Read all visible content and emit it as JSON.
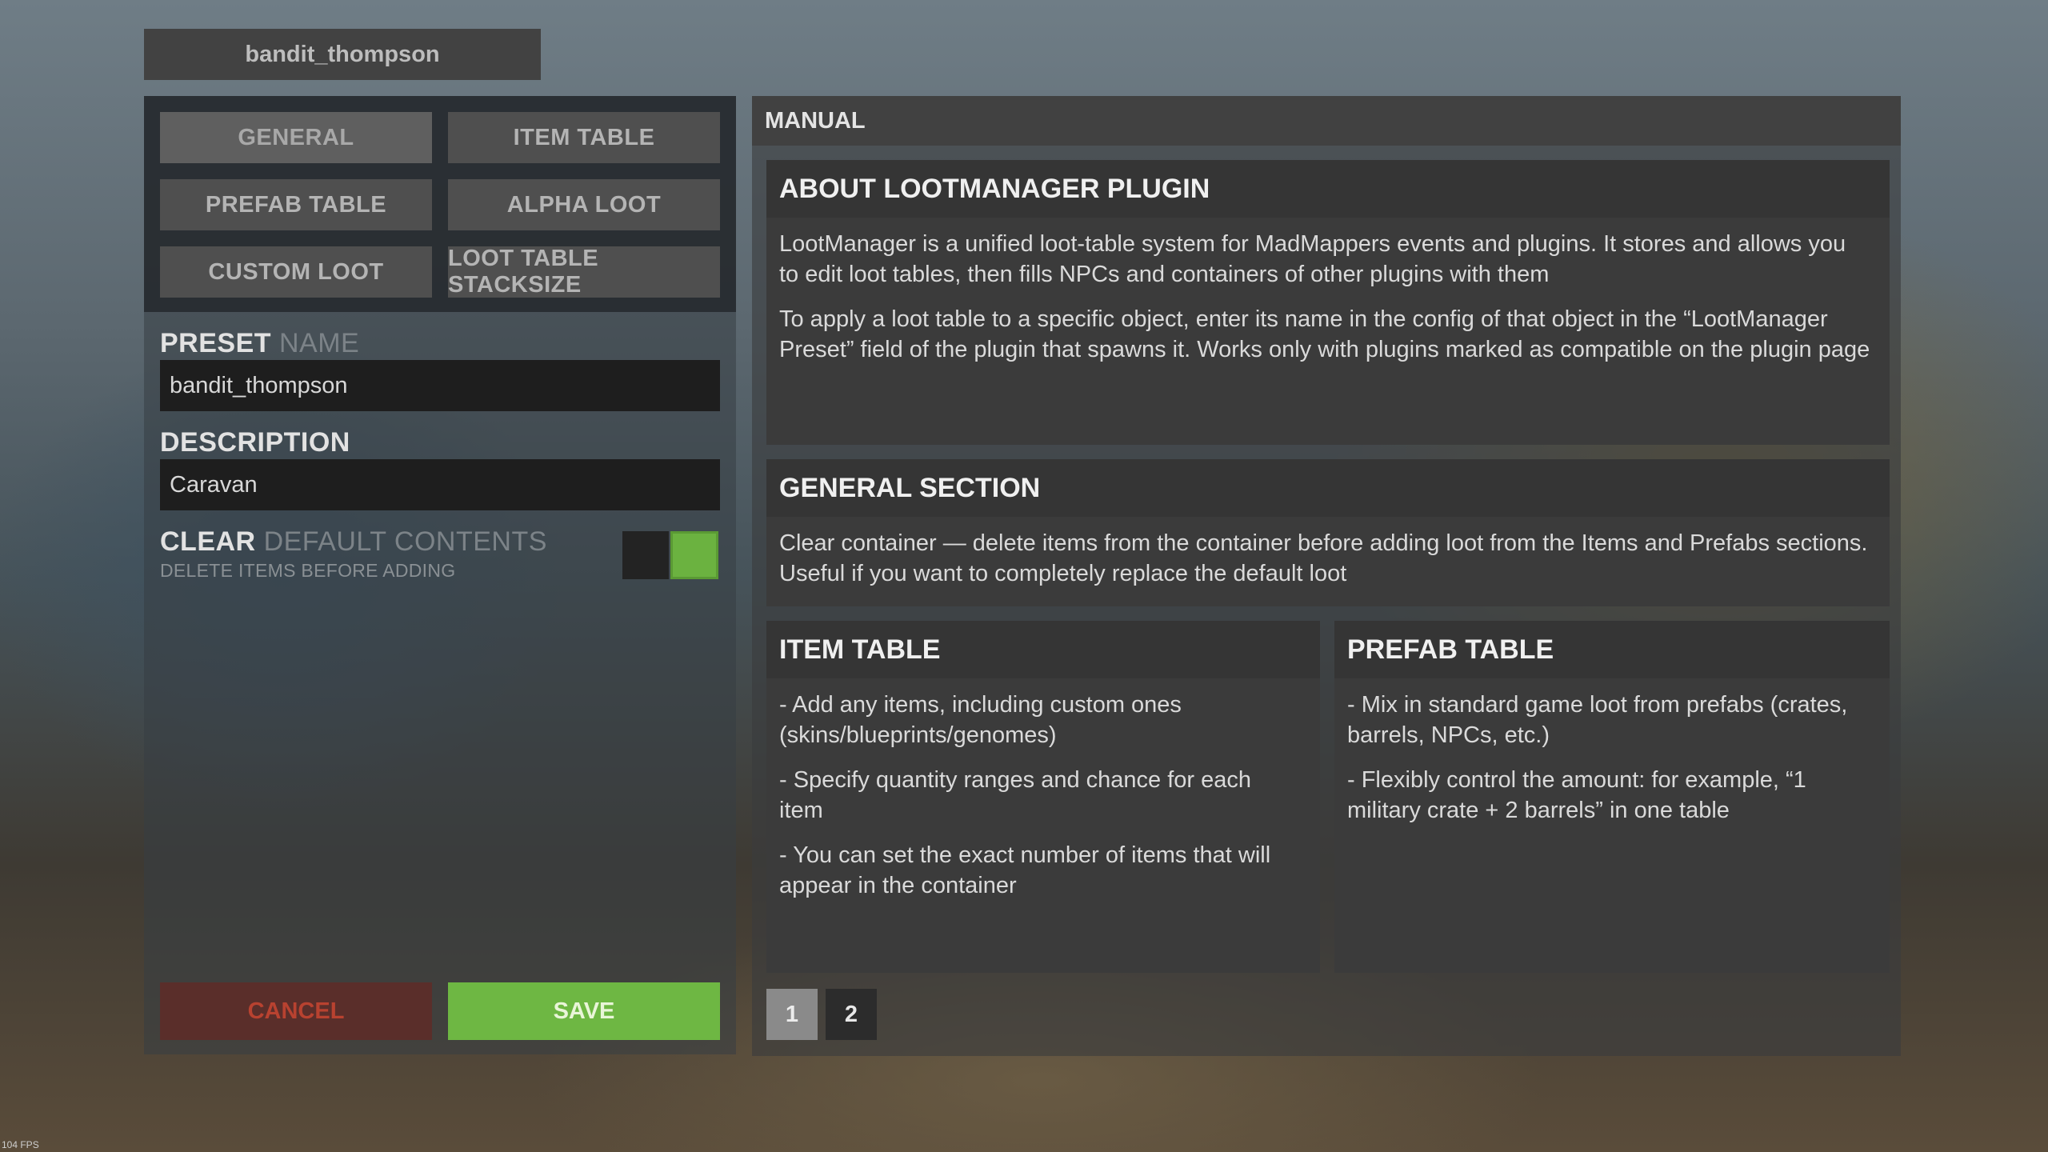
{
  "title": "bandit_thompson",
  "tabs": [
    "GENERAL",
    "ITEM TABLE",
    "PREFAB TABLE",
    "ALPHA LOOT",
    "CUSTOM LOOT",
    "LOOT TABLE STACKSIZE"
  ],
  "form": {
    "preset_label": "PRESET",
    "preset_label_dim": "NAME",
    "preset_value": "bandit_thompson",
    "description_label": "DESCRIPTION",
    "description_value": "Caravan",
    "clear_label": "CLEAR",
    "clear_label_dim": "DEFAULT CONTENTS",
    "clear_hint": "DELETE ITEMS BEFORE ADDING",
    "clear_enabled": true
  },
  "buttons": {
    "cancel": "CANCEL",
    "save": "SAVE"
  },
  "manual": {
    "header": "MANUAL",
    "about": {
      "title": "ABOUT LOOTMANAGER PLUGIN",
      "p1": "LootManager is a unified loot-table system for MadMappers events and plugins. It stores and allows you to edit loot tables, then fills NPCs and containers of other plugins with them",
      "p2": "To apply a loot table to a specific object, enter its name in the config of that object in the “LootManager Preset” field of the plugin that spawns it. Works only with plugins marked as compatible on the plugin page"
    },
    "general": {
      "title": "GENERAL SECTION",
      "p1": "Clear container — delete items from the container before adding loot from the Items and Prefabs sections. Useful if you want to completely replace the default loot"
    },
    "item_table": {
      "title": "ITEM TABLE",
      "items": [
        "- Add any items, including custom ones (skins/blueprints/genomes)",
        "- Specify quantity ranges and chance for each item",
        "- You can set the exact number of items that will appear in the container"
      ]
    },
    "prefab_table": {
      "title": "PREFAB TABLE",
      "items": [
        "- Mix in standard game loot from prefabs (crates, barrels, NPCs, etc.)",
        "- Flexibly control the amount: for example, “1 military crate + 2 barrels” in one table"
      ]
    },
    "pages": [
      "1",
      "2"
    ],
    "current_page": "1"
  },
  "fps": "104 FPS",
  "colors": {
    "save": "#6eb743",
    "cancel_text": "#b84230",
    "toggle_on": "#6bb240"
  }
}
